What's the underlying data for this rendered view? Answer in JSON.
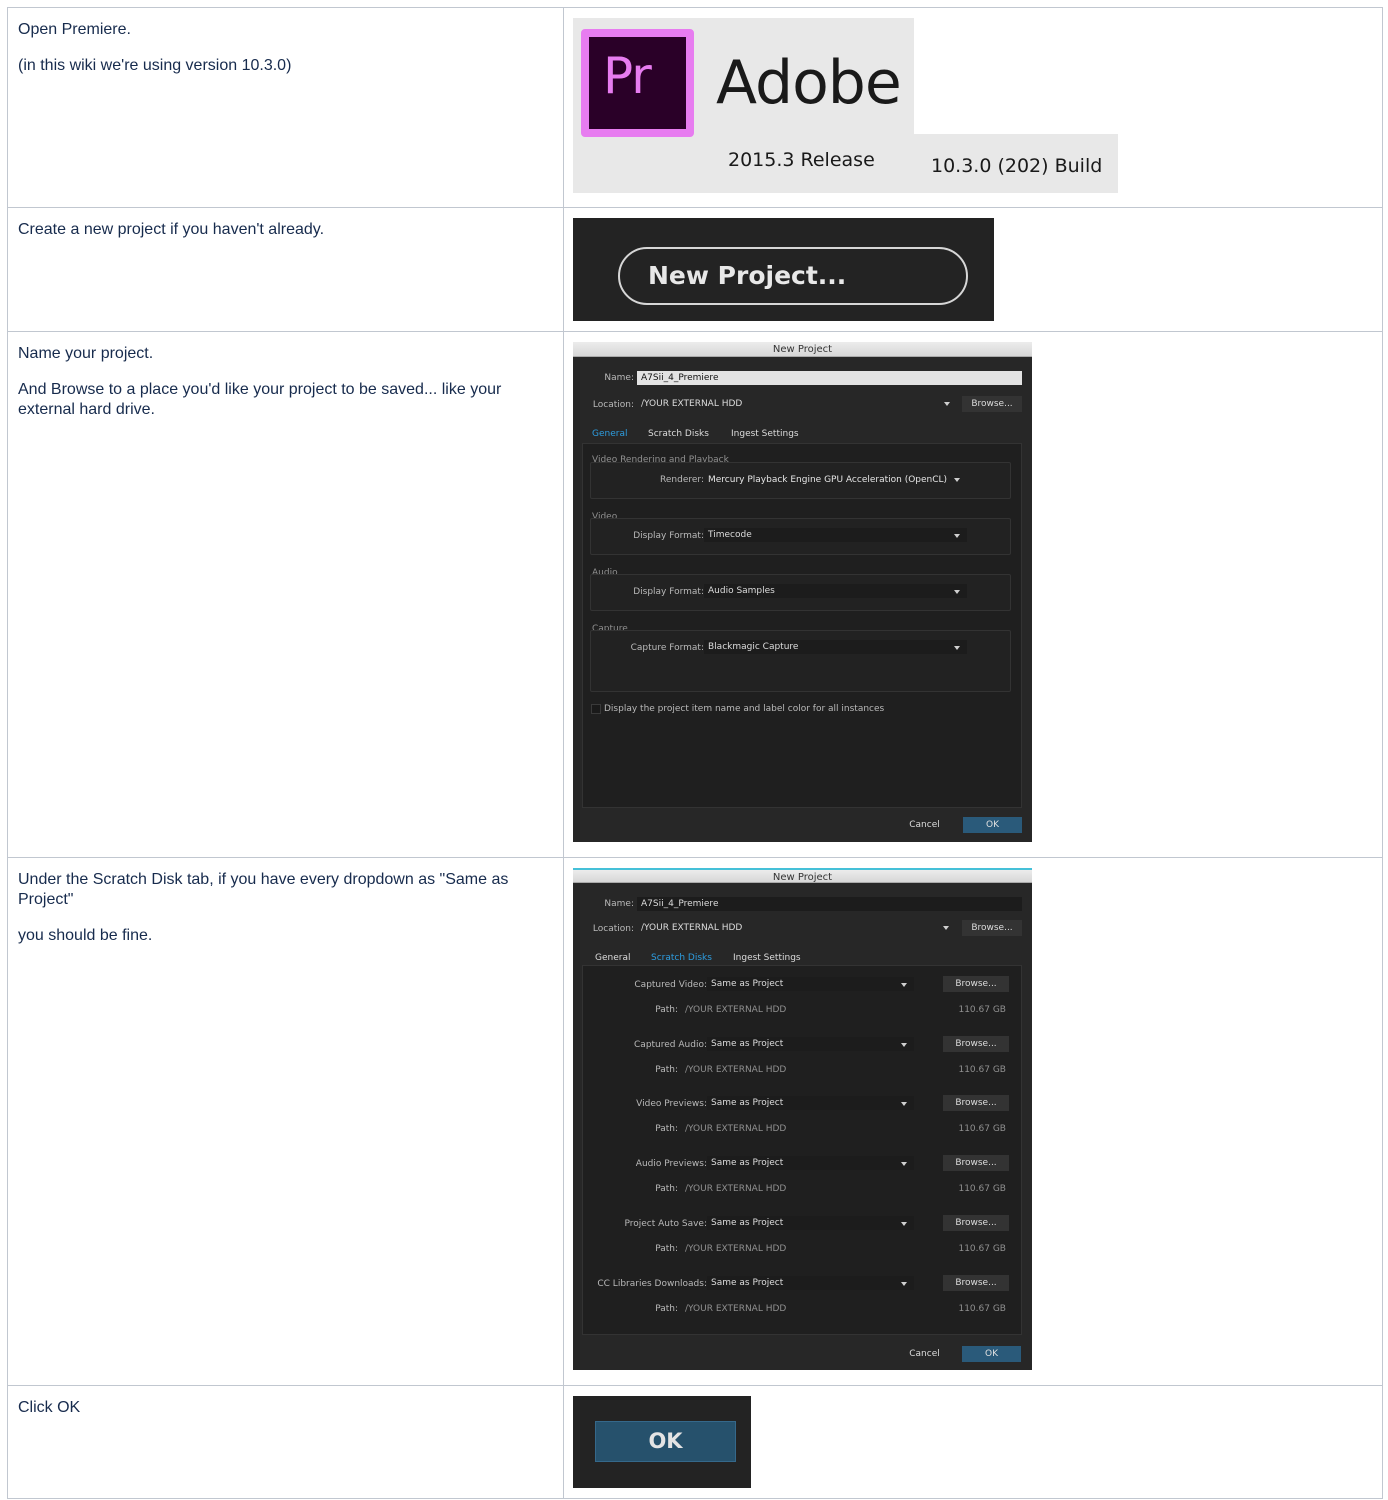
{
  "rows": [
    {
      "paragraphs": [
        "Open Premiere.",
        "(in this wiki we're using version 10.3.0)"
      ]
    },
    {
      "paragraphs": [
        "Create a new project if you haven't already."
      ]
    },
    {
      "paragraphs": [
        "Name your project.",
        "And Browse to a place you'd like your project to be saved... like your external hard drive."
      ]
    },
    {
      "paragraphs": [
        "Under the Scratch Disk tab, if you have every dropdown as \"Same as Project\"",
        "you should be fine."
      ]
    },
    {
      "paragraphs": [
        "Click OK"
      ]
    }
  ],
  "logo": {
    "icon_text": "Pr",
    "brand": "Adobe",
    "release": "2015.3 Release",
    "build": "10.3.0 (202) Build"
  },
  "new_project_button": "New Project...",
  "dialog1": {
    "title": "New Project",
    "name_label": "Name:",
    "name_value": "A7Sii_4_Premiere",
    "location_label": "Location:",
    "location_value": "/YOUR EXTERNAL HDD",
    "browse": "Browse...",
    "tabs": [
      "General",
      "Scratch Disks",
      "Ingest Settings"
    ],
    "active_tab": "General",
    "groups": [
      {
        "title": "Video Rendering and Playback",
        "label": "Renderer:",
        "value": "Mercury Playback Engine GPU Acceleration (OpenCL)"
      },
      {
        "title": "Video",
        "label": "Display Format:",
        "value": "Timecode"
      },
      {
        "title": "Audio",
        "label": "Display Format:",
        "value": "Audio Samples"
      },
      {
        "title": "Capture",
        "label": "Capture Format:",
        "value": "Blackmagic Capture"
      }
    ],
    "checkbox_label": "Display the project item name and label color for all instances",
    "cancel": "Cancel",
    "ok": "OK"
  },
  "dialog2": {
    "title": "New Project",
    "name_label": "Name:",
    "name_value": "A7Sii_4_Premiere",
    "location_label": "Location:",
    "location_value": "/YOUR EXTERNAL HDD",
    "browse": "Browse...",
    "tabs": [
      "General",
      "Scratch Disks",
      "Ingest Settings"
    ],
    "active_tab": "Scratch Disks",
    "disks": [
      {
        "label": "Captured Video:",
        "value": "Same as Project",
        "path_label": "Path:",
        "path": "/YOUR EXTERNAL HDD",
        "size": "110.67 GB"
      },
      {
        "label": "Captured Audio:",
        "value": "Same as Project",
        "path_label": "Path:",
        "path": "/YOUR EXTERNAL HDD",
        "size": "110.67 GB"
      },
      {
        "label": "Video Previews:",
        "value": "Same as Project",
        "path_label": "Path:",
        "path": "/YOUR EXTERNAL HDD",
        "size": "110.67 GB"
      },
      {
        "label": "Audio Previews:",
        "value": "Same as Project",
        "path_label": "Path:",
        "path": "/YOUR EXTERNAL HDD",
        "size": "110.67 GB"
      },
      {
        "label": "Project Auto Save:",
        "value": "Same as Project",
        "path_label": "Path:",
        "path": "/YOUR EXTERNAL HDD",
        "size": "110.67 GB"
      },
      {
        "label": "CC Libraries Downloads:",
        "value": "Same as Project",
        "path_label": "Path:",
        "path": "/YOUR EXTERNAL HDD",
        "size": "110.67 GB"
      }
    ],
    "cancel": "Cancel",
    "ok": "OK"
  },
  "ok_crop": "OK",
  "colors": {
    "border": "#c1c7d0",
    "pr_purple": "#e77cf0",
    "pr_bg": "#2a0028",
    "dialog_bg": "#272727",
    "tab_active": "#2d9de0",
    "ok_blue": "#2a5a7a"
  }
}
